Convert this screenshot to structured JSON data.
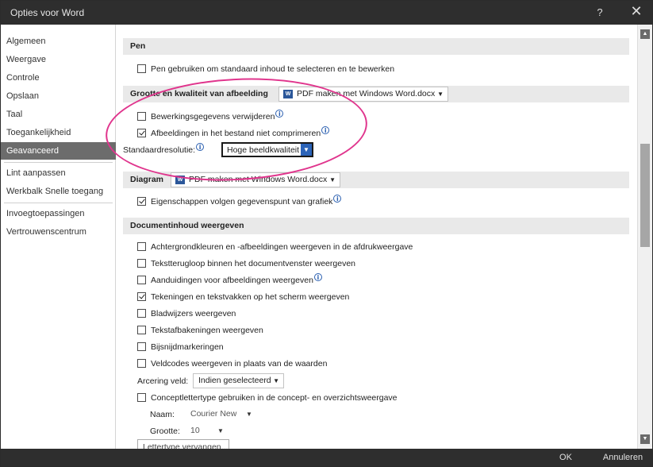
{
  "window": {
    "title": "Opties voor Word",
    "help": "?",
    "close": "✕"
  },
  "sidebar": {
    "items": [
      "Algemeen",
      "Weergave",
      "Controle",
      "Opslaan",
      "Taal",
      "Toegankelijkheid",
      "Geavanceerd",
      "Lint aanpassen",
      "Werkbalk Snelle toegang",
      "Invoegtoepassingen",
      "Vertrouwenscentrum"
    ],
    "active": "Geavanceerd"
  },
  "sections": {
    "pen": {
      "header": "Pen",
      "option": "Pen gebruiken om standaard inhoud te selecteren en te bewerken"
    },
    "image": {
      "header": "Grootte en kwaliteit van afbeelding",
      "document": "PDF maken met Windows Word.docx",
      "opt_remove": "Bewerkingsgegevens verwijderen",
      "opt_nocompress": "Afbeeldingen in het bestand niet comprimeren",
      "res_label": "Standaardresolutie:",
      "res_value": "Hoge beeldkwaliteit"
    },
    "diagram": {
      "header": "Diagram",
      "document": "PDF maken met Windows Word.docx",
      "opt": "Eigenschappen volgen gegevenspunt van grafiek"
    },
    "display": {
      "header": "Documentinhoud weergeven",
      "options": [
        "Achtergrondkleuren en -afbeeldingen weergeven in de afdrukweergave",
        "Tekstterugloop binnen het documentvenster weergeven",
        "Aanduidingen voor afbeeldingen weergeven",
        "Tekeningen en tekstvakken op het scherm weergeven",
        "Bladwijzers weergeven",
        "Tekstafbakeningen weergeven",
        "Bijsnijdmarkeringen",
        "Veldcodes weergeven in plaats van de waarden"
      ],
      "shading_label": "Arcering veld:",
      "shading_value": "Indien geselecteerd",
      "draft_font": "Conceptlettertype gebruiken in de concept- en overzichtsweergave",
      "name_label": "Naam:",
      "name_value": "Courier New",
      "size_label": "Grootte:",
      "size_value": "10",
      "font_subst_button": "Lettertype vervangen..."
    }
  },
  "footer": {
    "ok": "OK",
    "cancel": "Annuleren"
  },
  "colors": {
    "titlebar": "#2e2e2e",
    "active_item": "#6c6c6c",
    "annotation": "#e0358d",
    "accent": "#2b63b8"
  }
}
